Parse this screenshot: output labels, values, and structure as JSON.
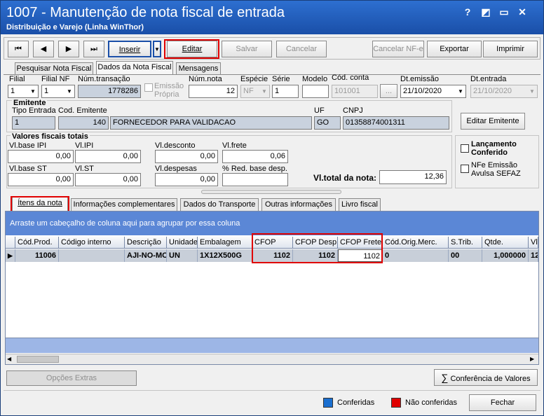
{
  "window": {
    "title": "1007 - Manutenção de nota fiscal de entrada",
    "subtitle": "Distribuição e Varejo (Linha WinThor)",
    "controls": [
      "?",
      "◩",
      "▭",
      "✕"
    ]
  },
  "toolbar": {
    "nav": [
      "⏮",
      "◀",
      "▶",
      "⏭"
    ],
    "inserir": "Inserir",
    "editar": "Editar",
    "salvar": "Salvar",
    "cancelar": "Cancelar",
    "cancelar_nfe": "Cancelar NF-e",
    "exportar": "Exportar",
    "imprimir": "Imprimir"
  },
  "main_tabs": [
    "Pesquisar Nota Fiscal",
    "Dados da Nota Fiscal",
    "Mensagens"
  ],
  "header_fields": {
    "filial_label": "Filial",
    "filial": "1",
    "filial_nf_label": "Filial NF",
    "filial_nf": "1",
    "num_transacao_label": "Núm.transação",
    "num_transacao": "1778286",
    "emissao_propria_label": "Emissão Própria",
    "num_nota_label": "Núm.nota",
    "num_nota": "12",
    "especie_label": "Espécie",
    "especie": "NF",
    "serie_label": "Série",
    "serie": "1",
    "modelo_label": "Modelo",
    "modelo": "",
    "cod_conta_label": "Cód. conta",
    "cod_conta": "101001",
    "dt_emissao_label": "Dt.emissão",
    "dt_emissao": "21/10/2020",
    "dt_entrada_label": "Dt.entrada",
    "dt_entrada": "21/10/2020"
  },
  "emitente": {
    "section": "Emitente",
    "tipo_entrada_label": "Tipo Entrada",
    "tipo_entrada": "1",
    "cod_emitente_label": "Cod. Emitente",
    "cod_emitente": "140",
    "nome": "FORNECEDOR PARA VALIDACAO",
    "uf_label": "UF",
    "uf": "GO",
    "cnpj_label": "CNPJ",
    "cnpj": "01358874001311",
    "editar_emitente": "Editar Emitente"
  },
  "valores": {
    "section": "Valores fiscais totais",
    "base_ipi_label": "Vl.base IPI",
    "base_ipi": "0,00",
    "ipi_label": "Vl.IPI",
    "ipi": "0,00",
    "desconto_label": "Vl.desconto",
    "desconto": "0,00",
    "frete_label": "Vl.frete",
    "frete": "0,06",
    "base_st_label": "Vl.base ST",
    "base_st": "0,00",
    "st_label": "Vl.ST",
    "st": "0,00",
    "despesas_label": "Vl.despesas",
    "despesas": "0,00",
    "red_base_label": "% Red. base desp.",
    "red_base": "",
    "total_label": "Vl.total da nota:",
    "total": "12,36"
  },
  "flags": {
    "lancamento": "Lançamento Conferido",
    "nfe_avulsa": "NFe Emissão Avulsa SEFAZ"
  },
  "sub_tabs": [
    "Ítens da nota",
    "Informações complementares",
    "Dados do Transporte",
    "Outras informações",
    "Livro fiscal"
  ],
  "grid": {
    "group_hint": "Arraste um cabeçalho de coluna aqui para agrupar por essa coluna",
    "columns": [
      "Cód.Prod.",
      "Código interno",
      "Descrição",
      "Unidade",
      "Embalagem",
      "CFOP",
      "CFOP Desp.",
      "CFOP Frete",
      "Cód.Orig.Merc.",
      "S.Trib.",
      "Qtde.",
      "Vl."
    ],
    "rows": [
      [
        "11006",
        "",
        "AJI-NO-MO",
        "UN",
        "1X12X500G",
        "1102",
        "1102",
        "1102",
        "0",
        "00",
        "1,000000",
        "12"
      ]
    ]
  },
  "bottom": {
    "opcoes_extras": "Opções Extras",
    "conferencia": "Conferência de Valores",
    "legend_conferidas": "Conferidas",
    "legend_nao_conferidas": "Não conferidas",
    "fechar": "Fechar",
    "color_conferidas": "#1a6fd0",
    "color_nao_conferidas": "#e00000"
  }
}
